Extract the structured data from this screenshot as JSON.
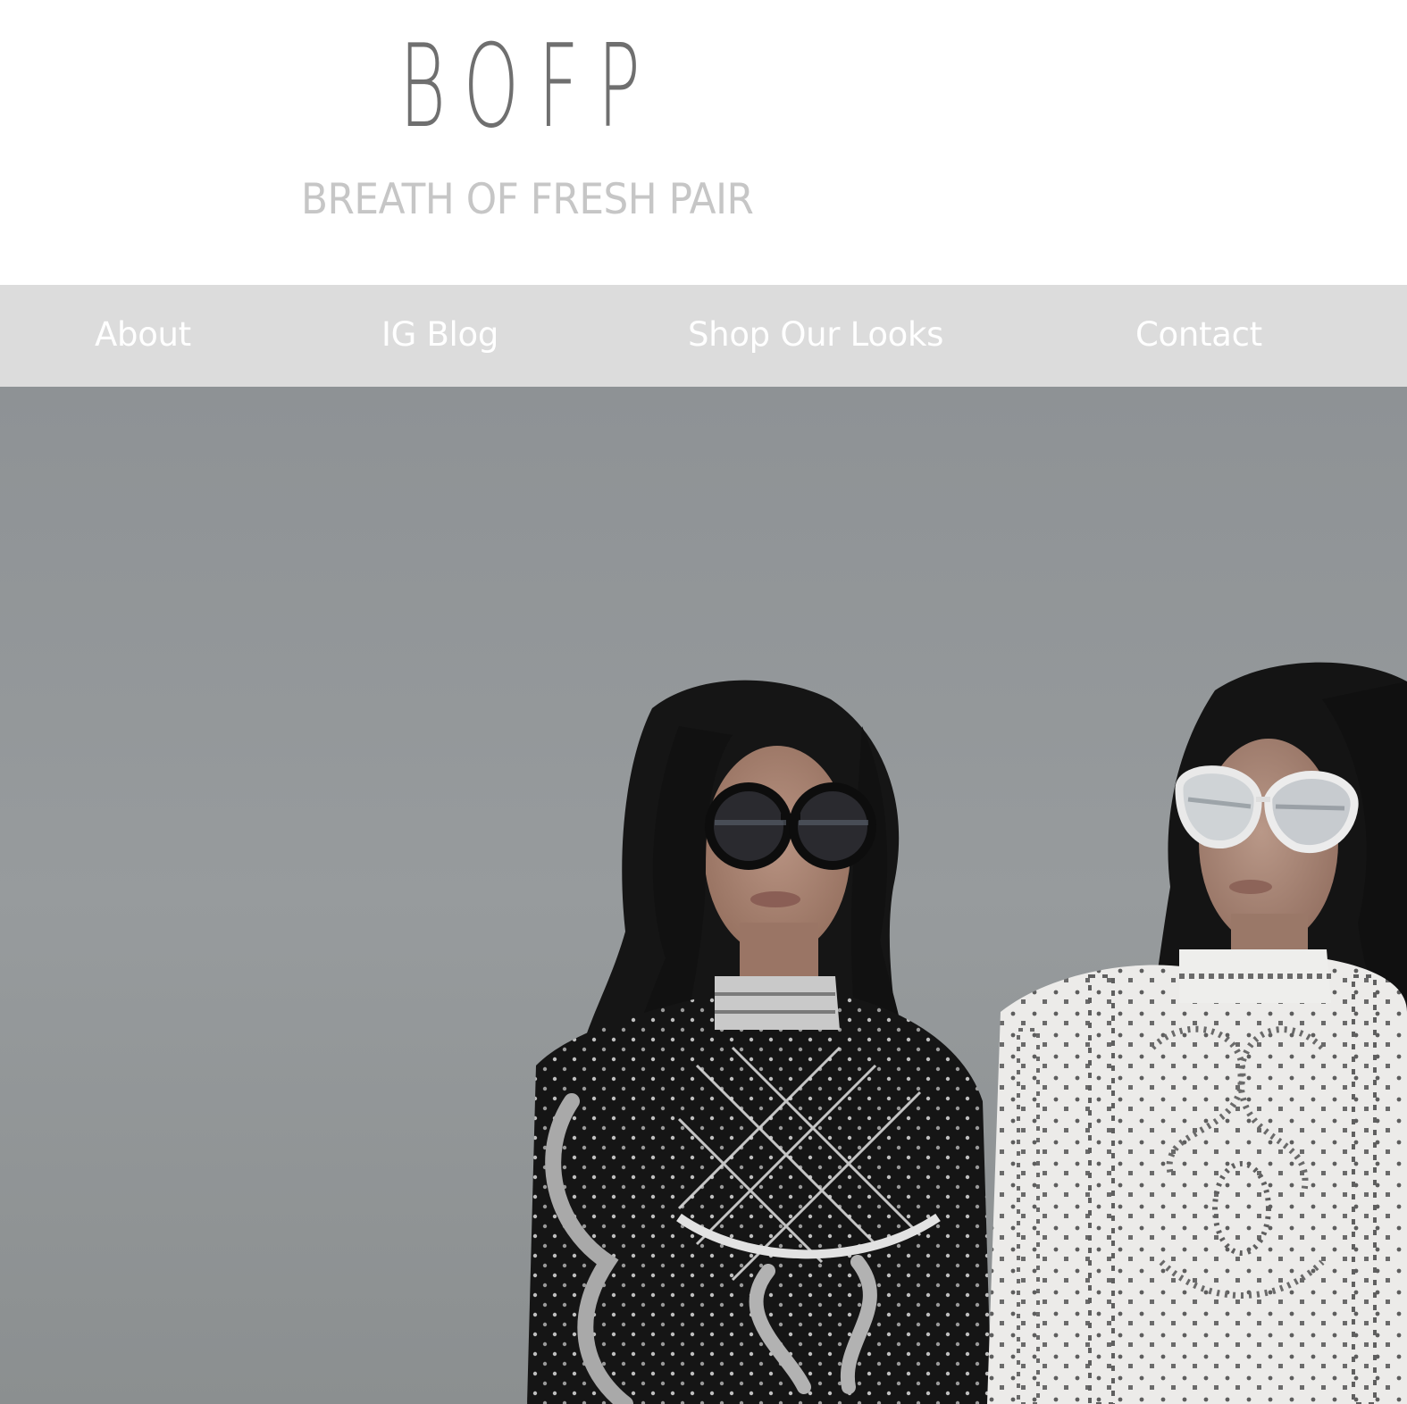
{
  "header": {
    "logo_text": "BOFP",
    "tagline": "BREATH OF FRESH PAIR"
  },
  "nav": {
    "items": [
      {
        "label": "About"
      },
      {
        "label": "IG Blog"
      },
      {
        "label": "Shop Our Looks"
      },
      {
        "label": "Contact"
      }
    ]
  },
  "hero": {
    "image_name": "hero-photo"
  },
  "colors": {
    "nav_background": "#dcdcdc",
    "logo": "#6f6f6f",
    "tagline": "#c6c6c6",
    "nav_text": "#ffffff",
    "hero_wall": "#93979a"
  }
}
